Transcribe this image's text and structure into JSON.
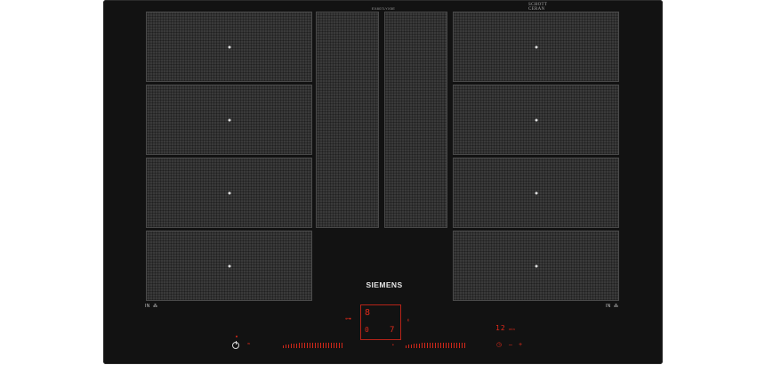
{
  "hob": {
    "model_label": "EX807LYX5E",
    "coating_brand": "SCHOTT CERAN",
    "coating_sub": "",
    "brand": "SIEMENS"
  },
  "left_flex": {
    "label": "IN",
    "symbol": "⁂"
  },
  "right_flex": {
    "label": "IN",
    "symbol": "⁂"
  },
  "display": {
    "left_power_level": "8",
    "left_small_level": "0",
    "right_digit": "7",
    "timer_value": "12",
    "timer_unit": "min"
  },
  "zones": {
    "count_left": 4,
    "count_right": 4,
    "count_center": 2
  },
  "colors": {
    "body": "#121212",
    "zone": "#3a3a3a",
    "display_red": "#e02a1a",
    "brand_text": "#e6e6e6"
  },
  "icons": {
    "power": "power-icon",
    "wave": "wave-icon",
    "key": "key-icon",
    "minus": "minus-icon",
    "plus": "plus-icon",
    "clock": "clock-icon"
  }
}
